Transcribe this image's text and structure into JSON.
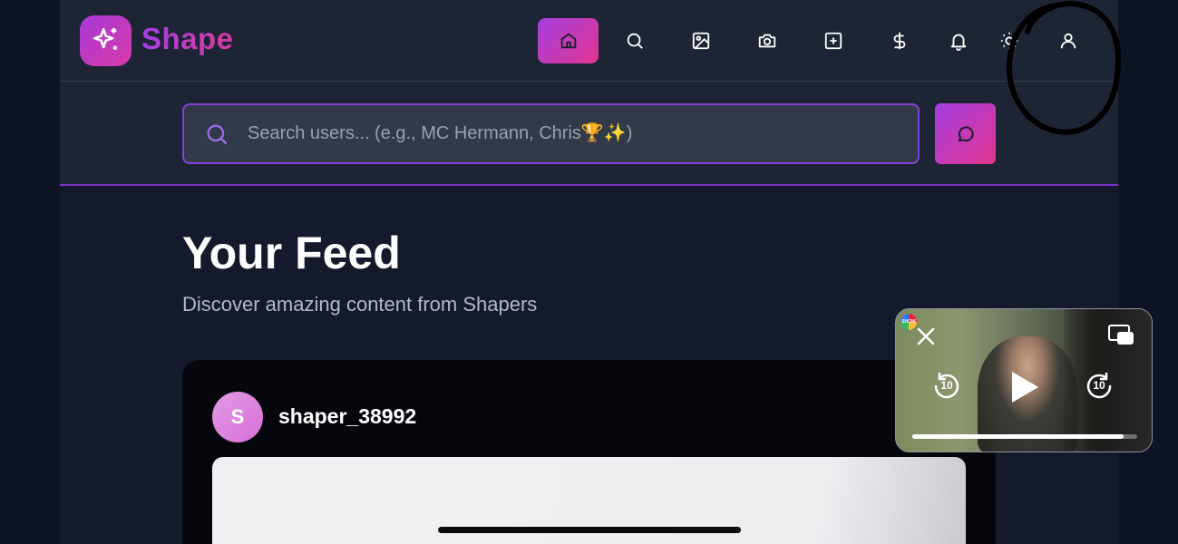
{
  "brand": {
    "name": "Shape"
  },
  "nav": {
    "items": [
      {
        "icon": "home-icon",
        "active": true
      },
      {
        "icon": "search-icon",
        "active": false
      },
      {
        "icon": "image-icon",
        "active": false
      },
      {
        "icon": "camera-icon",
        "active": false
      },
      {
        "icon": "plus-square-icon",
        "active": false
      },
      {
        "icon": "dollar-icon",
        "active": false
      },
      {
        "icon": "bell-icon",
        "active": false
      },
      {
        "icon": "sun-icon",
        "active": false
      },
      {
        "icon": "user-icon",
        "active": false
      }
    ]
  },
  "search": {
    "placeholder": "Search users... (e.g., MC Hermann, Chris🏆✨)",
    "value": ""
  },
  "feed": {
    "title": "Your Feed",
    "subtitle": "Discover amazing content from Shapers"
  },
  "post": {
    "avatar_initial": "S",
    "username": "shaper_38992"
  },
  "pip": {
    "skip_back": "10",
    "skip_forward": "10",
    "channel_badge": "SHOW",
    "progress": 0.94
  },
  "colors": {
    "accent_start": "#a63fe0",
    "accent_end": "#e0368f",
    "header_bg": "#1d2434",
    "page_bg": "#141a2b"
  }
}
